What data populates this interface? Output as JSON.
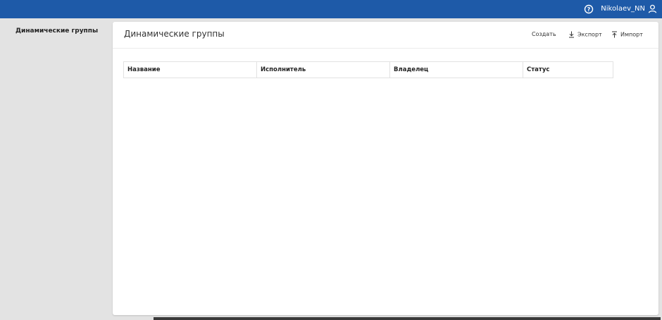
{
  "header": {
    "help_icon": "help-circle-icon",
    "username": "Nikolaev_NN",
    "user_icon": "user-icon"
  },
  "sidebar": {
    "items": [
      {
        "label": "Динамические группы"
      }
    ]
  },
  "main": {
    "title": "Динамические группы",
    "actions": {
      "create": "Создать",
      "export": "Экспорт",
      "import": "Импорт"
    },
    "table": {
      "columns": [
        "Название",
        "Исполнитель",
        "Владелец",
        "Статус"
      ],
      "rows": []
    }
  },
  "colors": {
    "topbar": "#1e5aa8",
    "sidebar_bg": "#e3e3e3",
    "panel_bg": "#ffffff"
  }
}
